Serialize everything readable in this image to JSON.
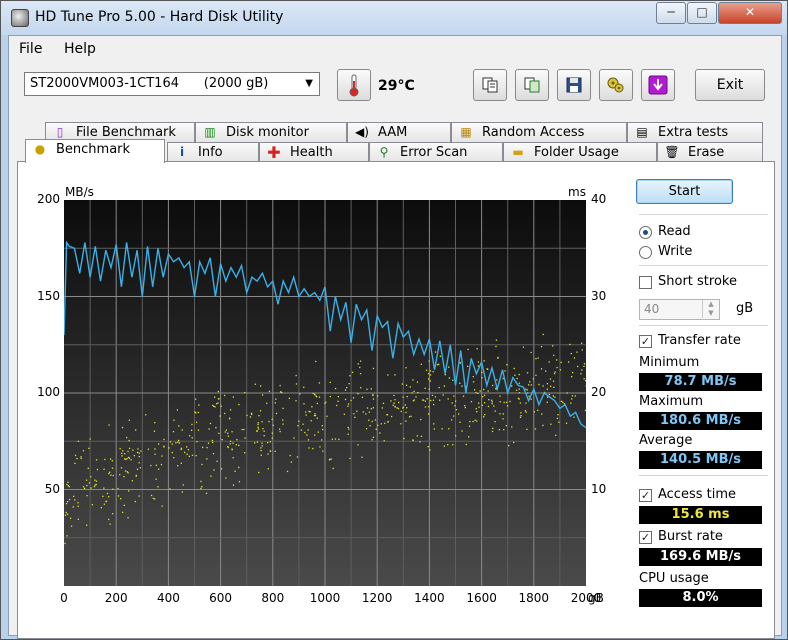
{
  "window": {
    "title": "HD Tune Pro 5.00 - Hard Disk Utility",
    "controls": {
      "minimize": "─",
      "maximize": "□",
      "close": "✕"
    }
  },
  "menu": {
    "file": "File",
    "help": "Help"
  },
  "toolbar": {
    "drive": "ST2000VM003-1CT164      (2000 gB)",
    "temperature": "29°C",
    "exit_label": "Exit",
    "icons": [
      "copy-text-icon",
      "copy-screenshot-icon",
      "save-icon",
      "options-icon",
      "download-icon"
    ]
  },
  "tabs": {
    "top_row": [
      "File Benchmark",
      "Disk monitor",
      "AAM",
      "Random Access",
      "Extra tests"
    ],
    "bottom_row": [
      "Benchmark",
      "Info",
      "Health",
      "Error Scan",
      "Folder Usage",
      "Erase"
    ],
    "active": "Benchmark"
  },
  "controls": {
    "start_label": "Start",
    "read_label": "Read",
    "write_label": "Write",
    "mode": "Read",
    "short_stroke_label": "Short stroke",
    "short_stroke_checked": false,
    "short_stroke_value": "40",
    "short_stroke_unit": "gB",
    "transfer_rate_label": "Transfer rate",
    "transfer_rate_checked": true,
    "access_time_label": "Access time",
    "access_time_checked": true,
    "burst_rate_label": "Burst rate",
    "burst_rate_checked": true
  },
  "stats": {
    "minimum_label": "Minimum",
    "minimum": "78.7 MB/s",
    "maximum_label": "Maximum",
    "maximum": "180.6 MB/s",
    "average_label": "Average",
    "average": "140.5 MB/s",
    "access_time": "15.6 ms",
    "burst_rate": "169.6 MB/s",
    "cpu_usage_label": "CPU usage",
    "cpu_usage": "8.0%"
  },
  "chart_data": {
    "type": "line",
    "y_left_label": "MB/s",
    "y_right_label": "ms",
    "x_unit": "gB",
    "xlim": [
      0,
      2000
    ],
    "ylim_left": [
      0,
      200
    ],
    "ylim_right": [
      0,
      40
    ],
    "x_ticks": [
      "0",
      "200",
      "400",
      "600",
      "800",
      "1000",
      "1200",
      "1400",
      "1600",
      "1800",
      "2000"
    ],
    "y_left_ticks": [
      "50",
      "100",
      "150",
      "200"
    ],
    "y_right_ticks": [
      "10",
      "20",
      "30",
      "40"
    ],
    "grid": true,
    "series": [
      {
        "name": "Transfer rate",
        "color": "#3ab0e8",
        "x": [
          0,
          10,
          20,
          40,
          60,
          80,
          100,
          120,
          140,
          160,
          180,
          200,
          220,
          240,
          260,
          280,
          300,
          320,
          340,
          360,
          380,
          400,
          420,
          440,
          460,
          480,
          500,
          520,
          540,
          560,
          580,
          600,
          620,
          640,
          660,
          680,
          700,
          720,
          740,
          760,
          780,
          800,
          820,
          840,
          860,
          880,
          900,
          920,
          940,
          960,
          980,
          1000,
          1020,
          1040,
          1060,
          1080,
          1100,
          1120,
          1140,
          1160,
          1180,
          1200,
          1220,
          1240,
          1260,
          1280,
          1300,
          1320,
          1340,
          1360,
          1380,
          1400,
          1420,
          1440,
          1460,
          1480,
          1500,
          1520,
          1540,
          1560,
          1580,
          1600,
          1620,
          1640,
          1660,
          1680,
          1700,
          1720,
          1740,
          1760,
          1780,
          1800,
          1820,
          1840,
          1860,
          1880,
          1900,
          1920,
          1940,
          1960,
          1980,
          2000
        ],
        "values": [
          130,
          178,
          176,
          175,
          162,
          178,
          160,
          176,
          158,
          174,
          165,
          177,
          155,
          178,
          160,
          174,
          150,
          176,
          155,
          175,
          160,
          172,
          168,
          170,
          165,
          168,
          150,
          168,
          162,
          170,
          150,
          167,
          158,
          165,
          160,
          166,
          152,
          160,
          158,
          162,
          155,
          158,
          146,
          158,
          152,
          160,
          150,
          154,
          150,
          152,
          148,
          155,
          132,
          150,
          138,
          147,
          126,
          146,
          138,
          143,
          122,
          140,
          134,
          137,
          118,
          136,
          129,
          132,
          120,
          128,
          120,
          128,
          112,
          127,
          110,
          125,
          104,
          122,
          100,
          118,
          110,
          116,
          104,
          113,
          102,
          112,
          100,
          108,
          104,
          103,
          96,
          102,
          94,
          100,
          98,
          96,
          92,
          94,
          88,
          90,
          84,
          82
        ]
      },
      {
        "name": "Access time",
        "color": "#e3e030",
        "type": "scatter",
        "x_min": 0,
        "x_max": 2000,
        "trend_ms": [
          [
            0,
            10
          ],
          [
            400,
            14
          ],
          [
            800,
            17
          ],
          [
            1200,
            18.5
          ],
          [
            1600,
            20
          ],
          [
            2000,
            21
          ]
        ],
        "spread_ms": 6,
        "count": 700
      }
    ]
  }
}
